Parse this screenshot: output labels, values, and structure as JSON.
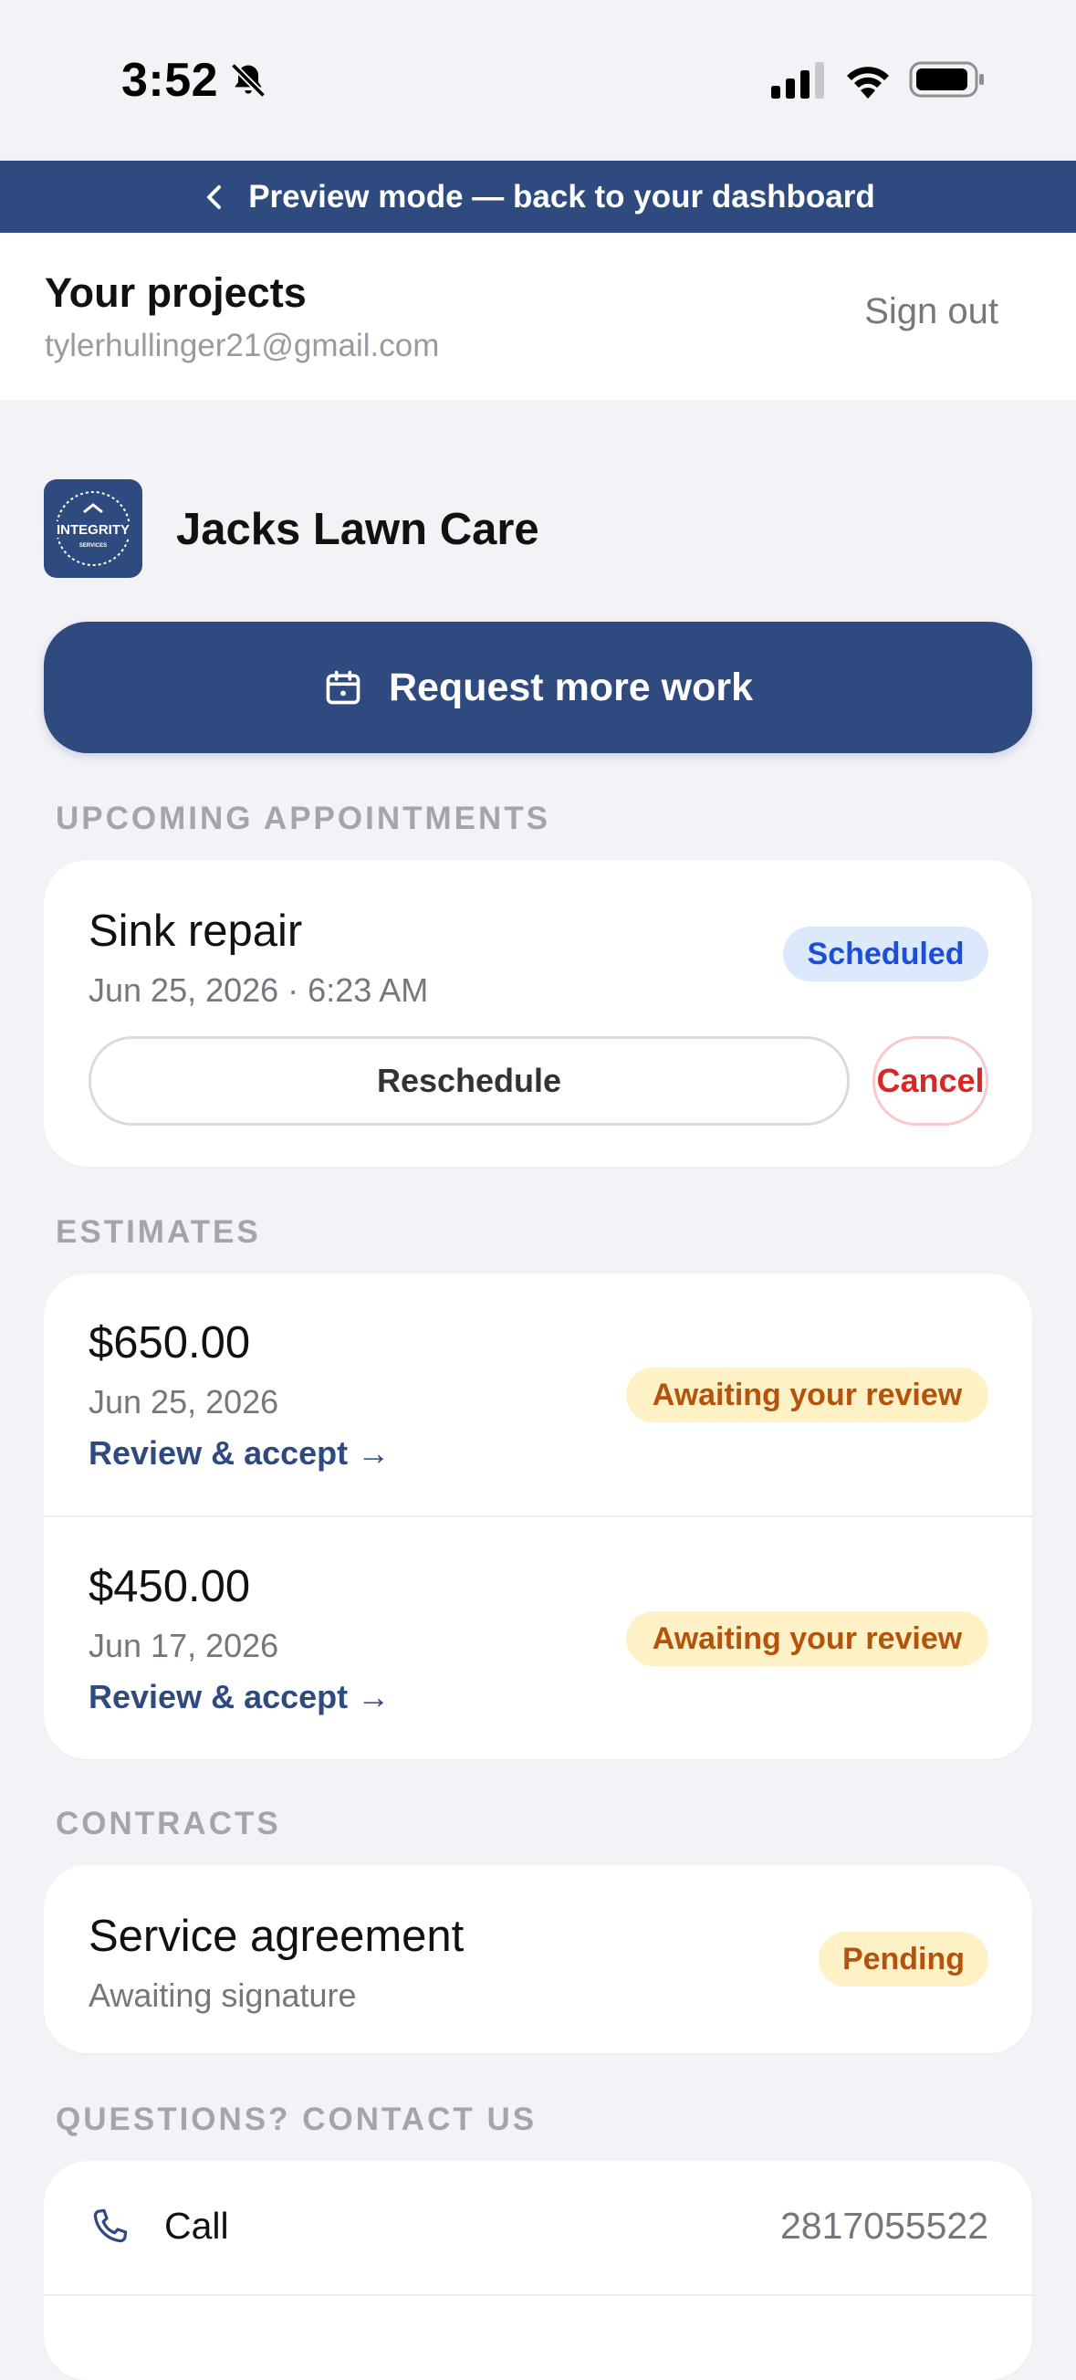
{
  "status_bar": {
    "time": "3:52",
    "icons": [
      "bell-slash-icon",
      "cellular-signal-icon",
      "wifi-icon",
      "battery-icon"
    ]
  },
  "preview_banner": {
    "label": "Preview mode — back to your dashboard",
    "icon": "chevron-left-icon",
    "bg_color": "#2F4A7E"
  },
  "header": {
    "title": "Your projects",
    "email": "tylerhullinger21@gmail.com",
    "sign_out": "Sign out"
  },
  "business": {
    "name": "Jacks Lawn Care",
    "logo_text": "INTEGRITY",
    "logo_subtext": "SERVICES"
  },
  "request_button": {
    "label": "Request more work",
    "icon": "calendar-icon"
  },
  "sections": {
    "upcoming": "UPCOMING APPOINTMENTS",
    "estimates": "ESTIMATES",
    "contracts": "CONTRACTS",
    "contact": "QUESTIONS? CONTACT US"
  },
  "appointment": {
    "title": "Sink repair",
    "datetime": "Jun 25, 2026 · 6:23 AM",
    "status": "Scheduled",
    "reschedule": "Reschedule",
    "cancel": "Cancel"
  },
  "estimates": [
    {
      "amount": "$650.00",
      "date": "Jun 25, 2026",
      "link": "Review & accept →",
      "status": "Awaiting your review"
    },
    {
      "amount": "$450.00",
      "date": "Jun 17, 2026",
      "link": "Review & accept →",
      "status": "Awaiting your review"
    }
  ],
  "contract": {
    "title": "Service agreement",
    "subtitle": "Awaiting signature",
    "status": "Pending"
  },
  "contact": {
    "call_label": "Call",
    "phone": "2817055522",
    "icon": "phone-icon"
  },
  "colors": {
    "brand": "#2F4A7E",
    "page_bg": "#F2F2F7",
    "badge_blue_text": "#1D4ED8",
    "badge_amber_text": "#B5530C",
    "cancel_red": "#DC2626"
  }
}
